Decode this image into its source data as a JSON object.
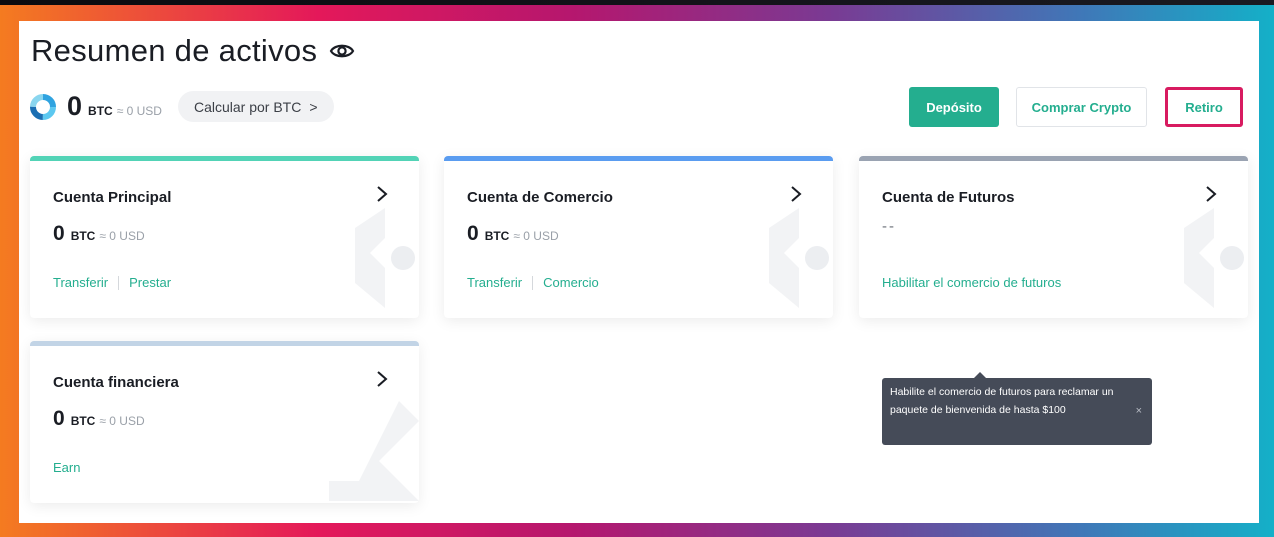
{
  "header": {
    "title": "Resumen de activos",
    "eye_icon": "eye-icon",
    "balance_value": "0",
    "balance_unit": "BTC",
    "balance_usd": "≈ 0 USD",
    "calc_label": "Calcular por BTC",
    "calc_chevron": ">"
  },
  "actions": {
    "deposit": "Depósito",
    "buy_crypto": "Comprar Crypto",
    "withdraw": "Retiro"
  },
  "cards": [
    {
      "name": "Cuenta Principal",
      "value": "0",
      "unit": "BTC",
      "usd": "≈ 0 USD",
      "links": [
        "Transferir",
        "Prestar"
      ],
      "accent": "#52d3b6"
    },
    {
      "name": "Cuenta de Comercio",
      "value": "0",
      "unit": "BTC",
      "usd": "≈ 0 USD",
      "links": [
        "Transferir",
        "Comercio"
      ],
      "accent": "#5a9cf0"
    },
    {
      "name": "Cuenta de Futuros",
      "value": "--",
      "links": [
        "Habilitar el comercio de futuros"
      ],
      "accent": "#9aa3b2"
    },
    {
      "name": "Cuenta financiera",
      "value": "0",
      "unit": "BTC",
      "usd": "≈ 0 USD",
      "links": [
        "Earn"
      ],
      "accent": "#c2d4e6"
    }
  ],
  "tooltip": {
    "text": "Habilite el comercio de futuros para reclamar un paquete de bienvenida de hasta $100",
    "close": "×"
  },
  "colors": {
    "brand_green": "#24ae8f",
    "highlight_border": "#d81b60",
    "tooltip_bg": "#454b58"
  }
}
